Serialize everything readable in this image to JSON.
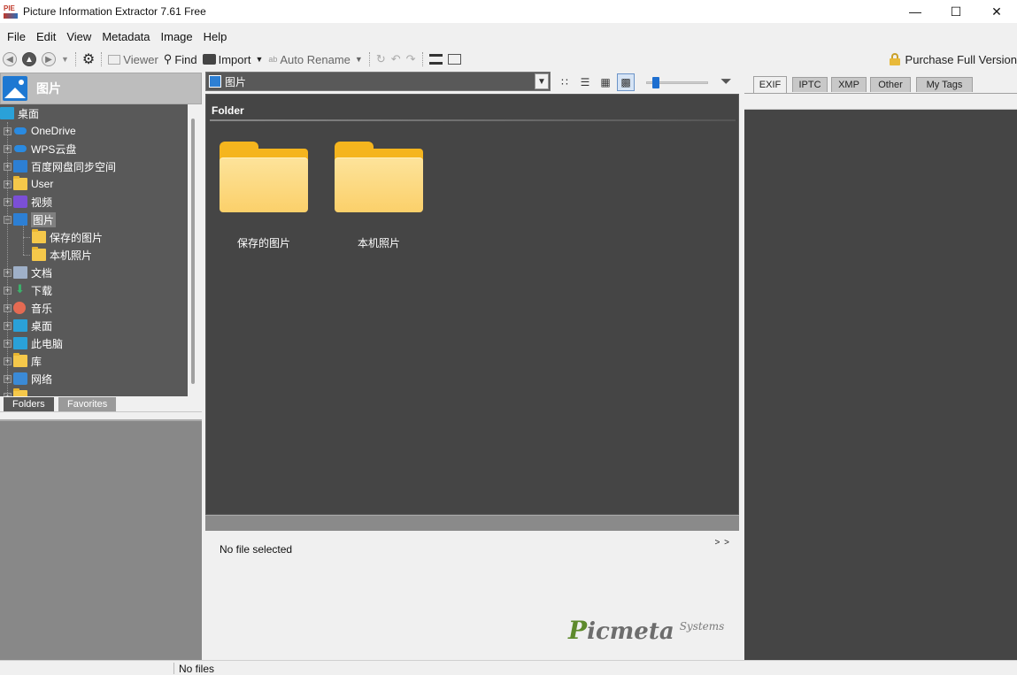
{
  "window": {
    "title": "Picture Information Extractor 7.61 Free",
    "app_icon_text": "PIE"
  },
  "menu": [
    "File",
    "Edit",
    "View",
    "Metadata",
    "Image",
    "Help"
  ],
  "toolbar": {
    "viewer": "Viewer",
    "find": "Find",
    "import": "Import",
    "auto_rename": "Auto Rename",
    "purchase": "Purchase Full Version"
  },
  "left_panel": {
    "header_title": "图片",
    "tree": {
      "root": "桌面",
      "items": [
        {
          "label": "OneDrive"
        },
        {
          "label": "WPS云盘"
        },
        {
          "label": "百度网盘同步空间"
        },
        {
          "label": "User"
        },
        {
          "label": "视频"
        },
        {
          "label": "图片"
        },
        {
          "label": "保存的图片"
        },
        {
          "label": "本机照片"
        },
        {
          "label": "文档"
        },
        {
          "label": "下载"
        },
        {
          "label": "音乐"
        },
        {
          "label": "桌面"
        },
        {
          "label": "此电脑"
        },
        {
          "label": "库"
        },
        {
          "label": "网络"
        }
      ]
    },
    "tabs": {
      "folders": "Folders",
      "favorites": "Favorites"
    }
  },
  "center": {
    "address": "图片",
    "section_header": "Folder",
    "folders": [
      {
        "name": "保存的图片"
      },
      {
        "name": "本机照片"
      }
    ],
    "info_text": "No file selected",
    "expand_label": "> >",
    "logo": {
      "p": "P",
      "rest": "icmeta",
      "systems": "Systems"
    }
  },
  "right_panel": {
    "tabs": [
      "EXIF",
      "IPTC",
      "XMP",
      "Other",
      "My Tags"
    ],
    "active_tab": "EXIF"
  },
  "statusbar": {
    "text": "No files"
  },
  "colors": {
    "pane_dark": "#454545",
    "tree_bg": "#595959",
    "accent_blue": "#1e6fd0"
  }
}
